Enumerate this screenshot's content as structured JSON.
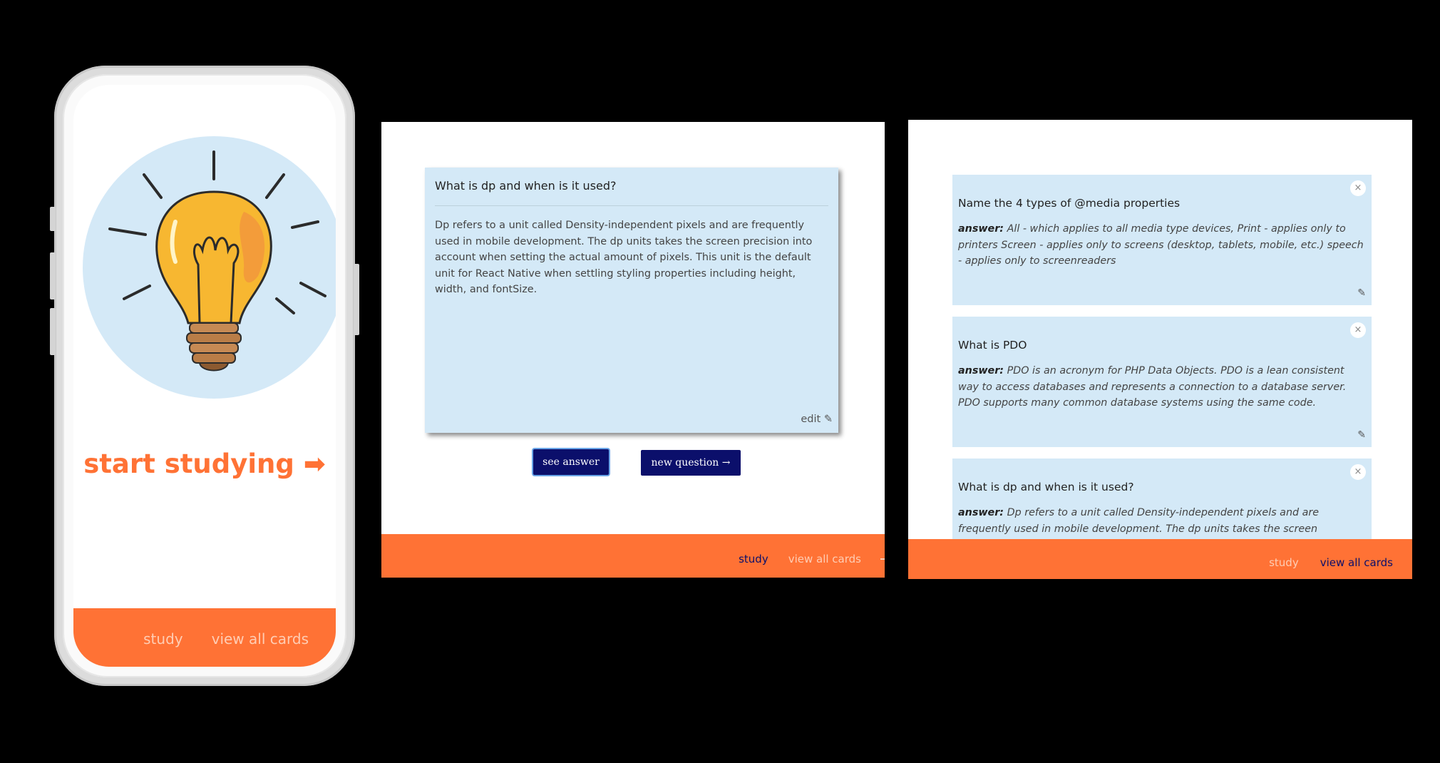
{
  "phone": {
    "start_label": "start studying ➡",
    "nav": {
      "study": "study",
      "view_all": "view all cards"
    },
    "illustration": "lightbulb-icon"
  },
  "study_view": {
    "question": "What is dp and when is it used?",
    "answer": "Dp refers to a unit called Density-independent pixels and are frequently used in mobile development. The dp units takes the screen precision into account when setting the actual amount of pixels. This unit is the default unit for React Native when settling styling properties including height, width, and fontSize.",
    "edit_label": "edit ✎",
    "see_answer_label": "see answer",
    "new_question_label": "new question →",
    "nav": {
      "study": "study",
      "view_all": "view all cards"
    }
  },
  "all_cards_view": {
    "answer_prefix": "answer:",
    "cards": [
      {
        "question": "Name the 4 types of @media properties",
        "answer": "All - which applies to all media type devices, Print - applies only to printers Screen - applies only to screens (desktop, tablets, mobile, etc.) speech - applies only to screenreaders"
      },
      {
        "question": "What is PDO",
        "answer": "PDO is an acronym for PHP Data Objects. PDO is a lean consistent way to access databases and represents a connection to a database server. PDO supports many common database systems using the same code."
      },
      {
        "question": "What is dp and when is it used?",
        "answer": "Dp refers to a unit called Density-independent pixels and are frequently used in mobile development. The dp units takes the screen"
      }
    ],
    "close_glyph": "×",
    "edit_glyph": "✎",
    "nav": {
      "study": "study",
      "view_all": "view all cards"
    }
  },
  "colors": {
    "accent_orange": "#ff7235",
    "card_blue": "#d4e9f7",
    "button_navy": "#0b0f6b",
    "nav_inactive": "#ffcdb4"
  }
}
